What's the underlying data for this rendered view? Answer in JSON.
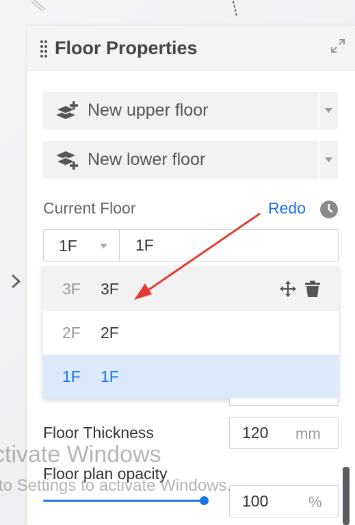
{
  "panel": {
    "title": "Floor Properties",
    "buttons": [
      {
        "label": "New upper floor",
        "icon": "add-layer-up-icon"
      },
      {
        "label": "New lower floor",
        "icon": "add-layer-down-icon"
      }
    ],
    "current_floor_label": "Current Floor",
    "redo_label": "Redo",
    "current_floor": {
      "short": "1F",
      "name": "1F"
    },
    "floors": [
      {
        "short": "3F",
        "name": "3F",
        "state": "hover"
      },
      {
        "short": "2F",
        "name": "2F",
        "state": "normal"
      },
      {
        "short": "1F",
        "name": "1F",
        "state": "selected"
      }
    ],
    "thickness": {
      "label": "Floor Thickness",
      "value": "120",
      "unit": "mm"
    },
    "opacity": {
      "label": "Floor plan opacity",
      "value": "100",
      "unit": "%",
      "level": 1.0
    }
  },
  "watermark": {
    "line1": "ctivate Windows",
    "line2": "to Settings to activate Windows."
  },
  "colors": {
    "accent": "#1a73e8",
    "annotation_arrow": "#e53935"
  }
}
